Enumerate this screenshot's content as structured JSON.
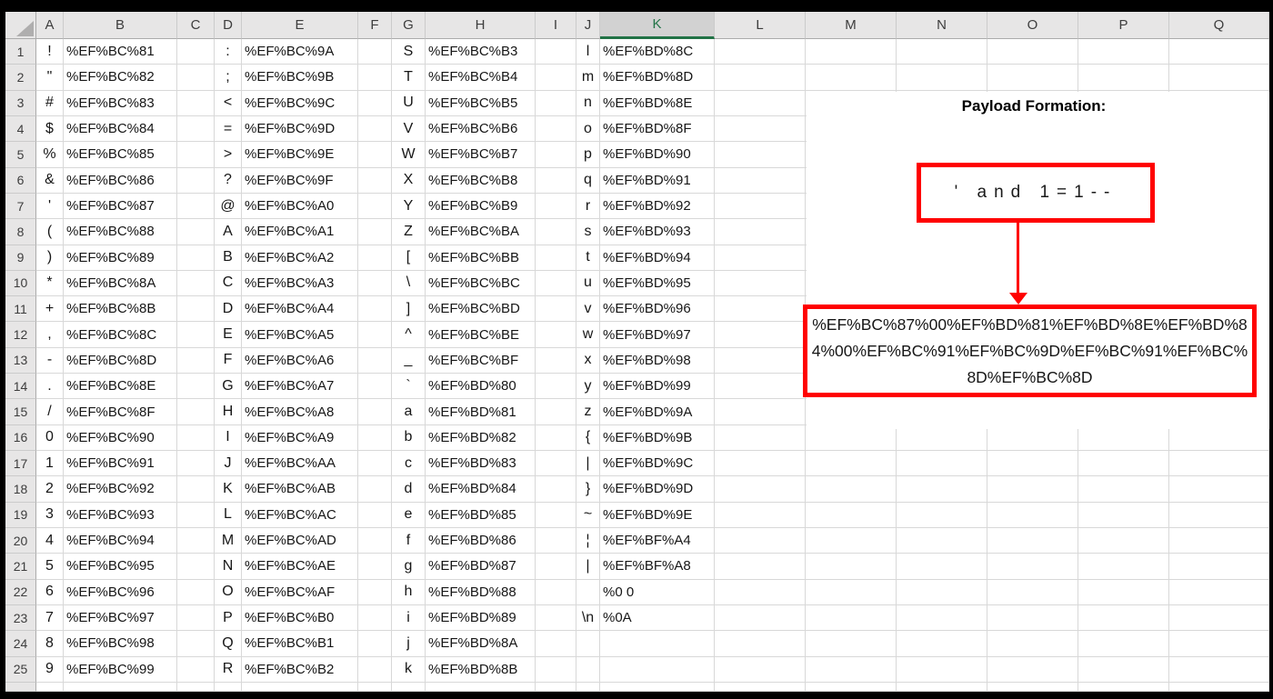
{
  "colors": {
    "annotation_red": "#FF0000",
    "selected_header_green": "#217346",
    "header_gray": "#E7E6E6",
    "frame_black": "#000000"
  },
  "sheet": {
    "column_headers": [
      "",
      "A",
      "B",
      "C",
      "D",
      "E",
      "F",
      "G",
      "H",
      "I",
      "J",
      "K",
      "L",
      "M",
      "N",
      "O",
      "P",
      "Q"
    ],
    "selected_column": "K",
    "rows": [
      [
        "1",
        "!",
        "%EF%BC%81",
        ":",
        "%EF%BC%9A",
        "S",
        "%EF%BC%B3",
        "l",
        "%EF%BD%8C"
      ],
      [
        "2",
        "\"",
        "%EF%BC%82",
        ";",
        "%EF%BC%9B",
        "T",
        "%EF%BC%B4",
        "m",
        "%EF%BD%8D"
      ],
      [
        "3",
        "#",
        "%EF%BC%83",
        "<",
        "%EF%BC%9C",
        "U",
        "%EF%BC%B5",
        "n",
        "%EF%BD%8E"
      ],
      [
        "4",
        "$",
        "%EF%BC%84",
        "=",
        "%EF%BC%9D",
        "V",
        "%EF%BC%B6",
        "o",
        "%EF%BD%8F"
      ],
      [
        "5",
        "%",
        "%EF%BC%85",
        ">",
        "%EF%BC%9E",
        "W",
        "%EF%BC%B7",
        "p",
        "%EF%BD%90"
      ],
      [
        "6",
        "&",
        "%EF%BC%86",
        "?",
        "%EF%BC%9F",
        "X",
        "%EF%BC%B8",
        "q",
        "%EF%BD%91"
      ],
      [
        "7",
        "'",
        "%EF%BC%87",
        "@",
        "%EF%BC%A0",
        "Y",
        "%EF%BC%B9",
        "r",
        "%EF%BD%92"
      ],
      [
        "8",
        "(",
        "%EF%BC%88",
        "A",
        "%EF%BC%A1",
        "Z",
        "%EF%BC%BA",
        "s",
        "%EF%BD%93"
      ],
      [
        "9",
        ")",
        "%EF%BC%89",
        "B",
        "%EF%BC%A2",
        "[",
        "%EF%BC%BB",
        "t",
        "%EF%BD%94"
      ],
      [
        "10",
        "*",
        "%EF%BC%8A",
        "C",
        "%EF%BC%A3",
        "\\",
        "%EF%BC%BC",
        "u",
        "%EF%BD%95"
      ],
      [
        "11",
        "+",
        "%EF%BC%8B",
        "D",
        "%EF%BC%A4",
        "]",
        "%EF%BC%BD",
        "v",
        "%EF%BD%96"
      ],
      [
        "12",
        ",",
        "%EF%BC%8C",
        "E",
        "%EF%BC%A5",
        "^",
        "%EF%BC%BE",
        "w",
        "%EF%BD%97"
      ],
      [
        "13",
        "-",
        "%EF%BC%8D",
        "F",
        "%EF%BC%A6",
        "_",
        "%EF%BC%BF",
        "x",
        "%EF%BD%98"
      ],
      [
        "14",
        ".",
        "%EF%BC%8E",
        "G",
        "%EF%BC%A7",
        "`",
        "%EF%BD%80",
        "y",
        "%EF%BD%99"
      ],
      [
        "15",
        "/",
        "%EF%BC%8F",
        "H",
        "%EF%BC%A8",
        "a",
        "%EF%BD%81",
        "z",
        "%EF%BD%9A"
      ],
      [
        "16",
        "0",
        "%EF%BC%90",
        "I",
        "%EF%BC%A9",
        "b",
        "%EF%BD%82",
        "{",
        "%EF%BD%9B"
      ],
      [
        "17",
        "1",
        "%EF%BC%91",
        "J",
        "%EF%BC%AA",
        "c",
        "%EF%BD%83",
        "|",
        "%EF%BD%9C"
      ],
      [
        "18",
        "2",
        "%EF%BC%92",
        "K",
        "%EF%BC%AB",
        "d",
        "%EF%BD%84",
        "}",
        "%EF%BD%9D"
      ],
      [
        "19",
        "3",
        "%EF%BC%93",
        "L",
        "%EF%BC%AC",
        "e",
        "%EF%BD%85",
        "~",
        "%EF%BD%9E"
      ],
      [
        "20",
        "4",
        "%EF%BC%94",
        "M",
        "%EF%BC%AD",
        "f",
        "%EF%BD%86",
        "¦",
        "%EF%BF%A4"
      ],
      [
        "21",
        "5",
        "%EF%BC%95",
        "N",
        "%EF%BC%AE",
        "g",
        "%EF%BD%87",
        "|",
        "%EF%BF%A8"
      ],
      [
        "22",
        "6",
        "%EF%BC%96",
        "O",
        "%EF%BC%AF",
        "h",
        "%EF%BD%88",
        "",
        "%0 0"
      ],
      [
        "23",
        "7",
        "%EF%BC%97",
        "P",
        "%EF%BC%B0",
        "i",
        "%EF%BD%89",
        "\\n",
        "%0A"
      ],
      [
        "24",
        "8",
        "%EF%BC%98",
        "Q",
        "%EF%BC%B1",
        "j",
        "%EF%BD%8A",
        "",
        ""
      ],
      [
        "25",
        "9",
        "%EF%BC%99",
        "R",
        "%EF%BC%B2",
        "k",
        "%EF%BD%8B",
        "",
        ""
      ]
    ]
  },
  "annotation": {
    "title": "Payload Formation:",
    "payload_plain": "' and 1=1--",
    "payload_encoded": "%EF%BC%87%00%EF%BD%81%EF%BD%8E%EF%BD%84%00%EF%BC%91%EF%BC%9D%EF%BC%91%EF%BC%8D%EF%BC%8D"
  }
}
